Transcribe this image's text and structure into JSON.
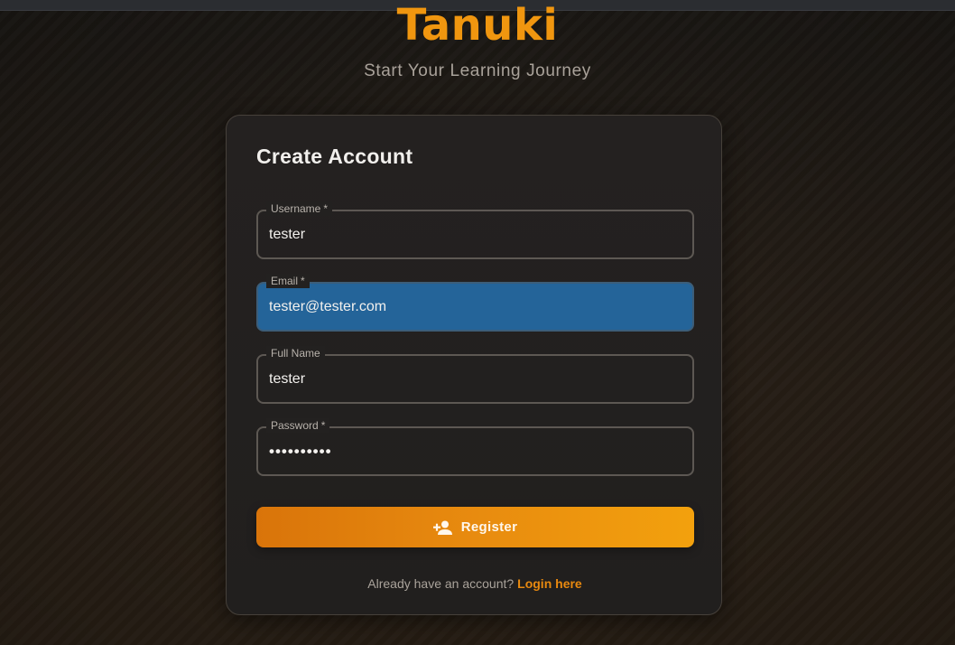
{
  "app": {
    "brand": "Tanuki",
    "tagline": "Start Your Learning Journey"
  },
  "form": {
    "title": "Create Account",
    "fields": [
      {
        "label": "Username",
        "required": "*",
        "value": "tester"
      },
      {
        "label": "Email",
        "required": "*",
        "value": "tester@tester.com"
      },
      {
        "label": "Full Name",
        "required": "",
        "value": "tester"
      },
      {
        "label": "Password",
        "required": "*",
        "value": "••••••••••"
      }
    ],
    "register_button": {
      "label": "Register",
      "icon": "person-add-icon"
    },
    "login_prompt": "Already have an account?",
    "login_link": "Login here"
  },
  "colors": {
    "accent": "#f0960f",
    "focused_field": "#246499"
  }
}
